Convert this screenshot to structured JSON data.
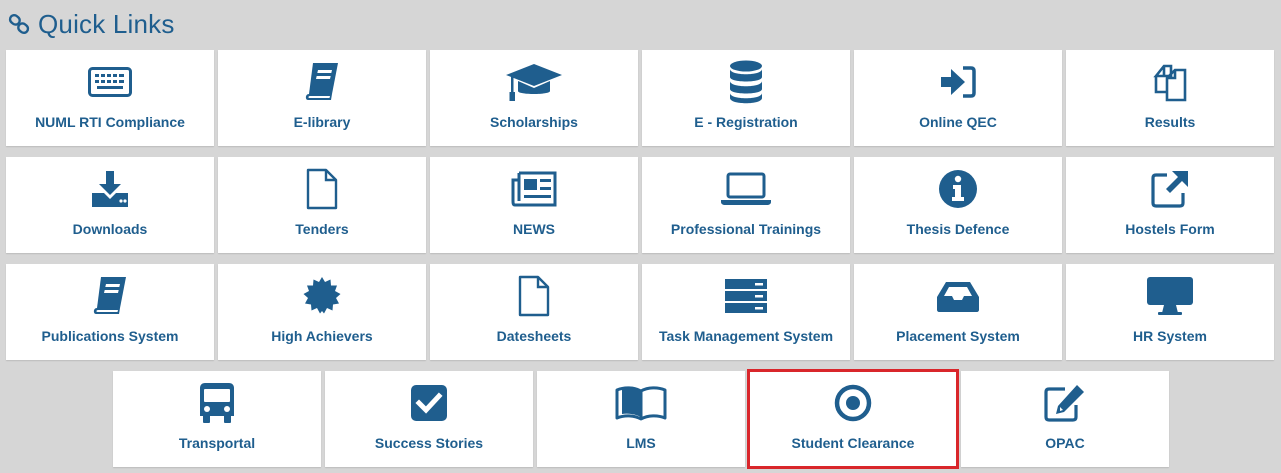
{
  "header": {
    "title": "Quick Links",
    "icon": "link-icon"
  },
  "accent_color": "#1f5e8e",
  "highlight_color": "#d9262b",
  "rows": [
    [
      {
        "label": "NUML RTI Compliance",
        "icon": "keyboard-icon"
      },
      {
        "label": "E-library",
        "icon": "book-icon"
      },
      {
        "label": "Scholarships",
        "icon": "graduation-cap-icon"
      },
      {
        "label": "E - Registration",
        "icon": "database-icon"
      },
      {
        "label": "Online QEC",
        "icon": "sign-in-icon"
      },
      {
        "label": "Results",
        "icon": "files-icon"
      }
    ],
    [
      {
        "label": "Downloads",
        "icon": "download-icon"
      },
      {
        "label": "Tenders",
        "icon": "file-icon"
      },
      {
        "label": "NEWS",
        "icon": "newspaper-icon"
      },
      {
        "label": "Professional Trainings",
        "icon": "laptop-icon"
      },
      {
        "label": "Thesis Defence",
        "icon": "info-circle-icon"
      },
      {
        "label": "Hostels Form",
        "icon": "external-link-icon"
      }
    ],
    [
      {
        "label": "Publications System",
        "icon": "book-icon"
      },
      {
        "label": "High Achievers",
        "icon": "certificate-icon"
      },
      {
        "label": "Datesheets",
        "icon": "file-icon"
      },
      {
        "label": "Task Management System",
        "icon": "server-icon"
      },
      {
        "label": "Placement System",
        "icon": "inbox-icon"
      },
      {
        "label": "HR System",
        "icon": "desktop-icon"
      }
    ],
    [
      {
        "label": "Transportal",
        "icon": "bus-icon"
      },
      {
        "label": "Success Stories",
        "icon": "check-square-icon"
      },
      {
        "label": "LMS",
        "icon": "open-book-icon"
      },
      {
        "label": "Student Clearance",
        "icon": "dot-circle-icon",
        "highlighted": true
      },
      {
        "label": "OPAC",
        "icon": "edit-icon"
      }
    ]
  ]
}
